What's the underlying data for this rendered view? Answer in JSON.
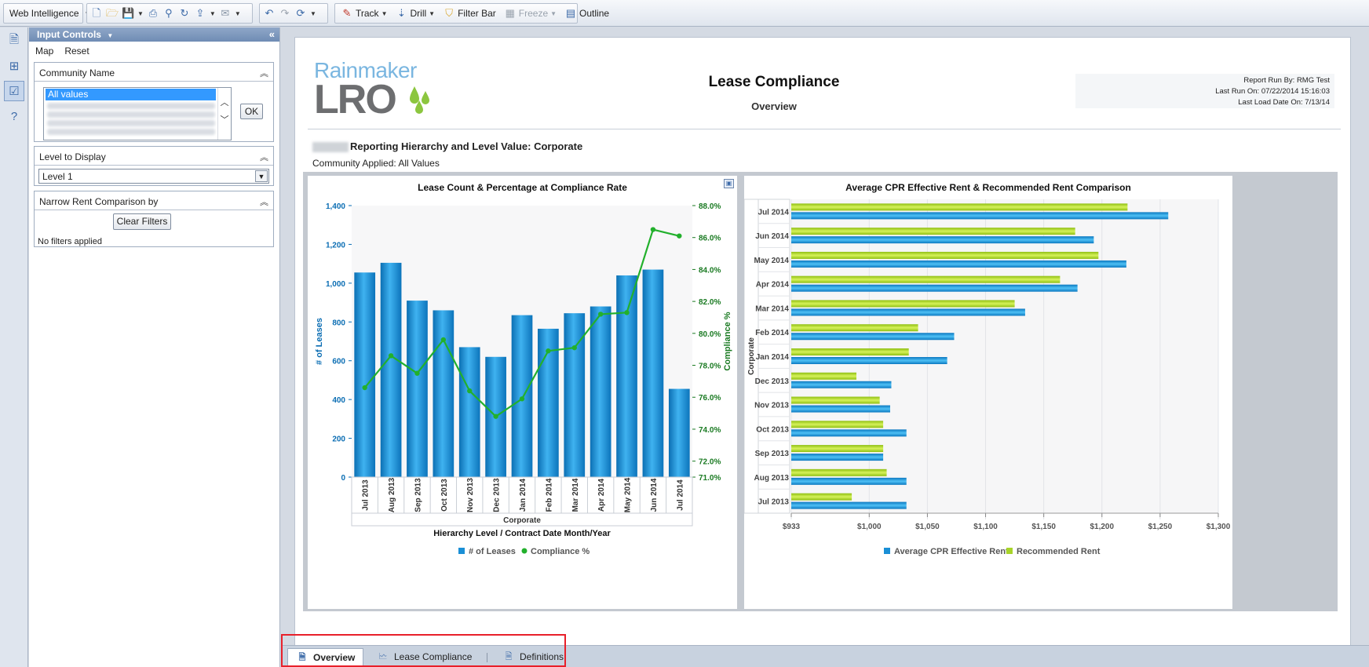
{
  "toolbar": {
    "app_menu": "Web Intelligence",
    "track": "Track",
    "drill": "Drill",
    "filter_bar": "Filter Bar",
    "freeze": "Freeze",
    "outline": "Outline"
  },
  "input_controls": {
    "title": "Input Controls",
    "menu_map": "Map",
    "menu_reset": "Reset",
    "community_title": "Community Name",
    "community_selected": "All values",
    "ok_label": "OK",
    "level_title": "Level to Display",
    "level_value": "Level 1",
    "narrow_title": "Narrow Rent Comparison by",
    "clear_filters": "Clear Filters",
    "no_filters": "No filters applied"
  },
  "report": {
    "logo_top": "Rainmaker",
    "logo_bottom": "LRO",
    "title": "Lease Compliance",
    "subtitle": "Overview",
    "run_by": "Report Run By:  RMG Test",
    "last_run": "Last Run On: 07/22/2014 15:16:03",
    "last_load": "Last Load Date On: 7/13/14",
    "hierarchy": "Reporting Hierarchy and Level Value: Corporate",
    "community_applied": "Community Applied: All Values"
  },
  "tabs": [
    "Overview",
    "Lease Compliance",
    "Definitions"
  ],
  "colors": {
    "bar_blue": "#1a8fd6",
    "line_green": "#22b02c",
    "recommended_green": "#a8d42a",
    "highlight_red": "#e8202a"
  },
  "chart_data": [
    {
      "type": "bar",
      "title": "Lease Count & Percentage at Compliance Rate",
      "categories": [
        "Jul 2013",
        "Aug 2013",
        "Sep 2013",
        "Oct 2013",
        "Nov 2013",
        "Dec 2013",
        "Jan 2014",
        "Feb 2014",
        "Mar 2014",
        "Apr 2014",
        "May 2014",
        "Jun 2014",
        "Jul 2014"
      ],
      "group_label": "Corporate",
      "xlabel": "Hierarchy Level / Contract Date Month/Year",
      "ylabel": "# of Leases",
      "y2label": "Compliance %",
      "ylim": [
        0,
        1400
      ],
      "yticks": [
        0,
        200,
        400,
        600,
        800,
        "1,000",
        "1,200",
        "1,400"
      ],
      "y2lim": [
        71,
        88
      ],
      "y2ticks": [
        "71.0%",
        "72.0%",
        "74.0%",
        "76.0%",
        "78.0%",
        "80.0%",
        "82.0%",
        "84.0%",
        "86.0%",
        "88.0%"
      ],
      "series": [
        {
          "name": "# of Leases",
          "kind": "bar",
          "values": [
            1055,
            1105,
            910,
            860,
            670,
            620,
            835,
            765,
            845,
            880,
            1040,
            1070,
            455
          ]
        },
        {
          "name": "Compliance %",
          "kind": "line",
          "values": [
            76.6,
            78.6,
            77.5,
            79.6,
            76.4,
            74.8,
            75.9,
            78.9,
            79.1,
            81.2,
            81.3,
            86.5,
            86.1
          ]
        }
      ],
      "legend": "bottom"
    },
    {
      "type": "bar",
      "orientation": "horizontal",
      "title": "Average CPR Effective Rent & Recommended Rent Comparison",
      "categories": [
        "Jul 2014",
        "Jun 2014",
        "May 2014",
        "Apr 2014",
        "Mar 2014",
        "Feb 2014",
        "Jan 2014",
        "Dec 2013",
        "Nov 2013",
        "Oct 2013",
        "Sep 2013",
        "Aug 2013",
        "Jul 2013"
      ],
      "group_label": "Corporate",
      "xlim": [
        933,
        1300
      ],
      "xticks": [
        "$933",
        "$1,000",
        "$1,050",
        "$1,100",
        "$1,150",
        "$1,200",
        "$1,250",
        "$1,300"
      ],
      "series": [
        {
          "name": "Recommended Rent",
          "values": [
            1222,
            1177,
            1197,
            1164,
            1125,
            1042,
            1034,
            989,
            1009,
            1012,
            1012,
            1015,
            985
          ]
        },
        {
          "name": "Average CPR Effective Rent",
          "values": [
            1257,
            1193,
            1221,
            1179,
            1134,
            1073,
            1067,
            1019,
            1018,
            1032,
            1012,
            1032,
            1032
          ]
        }
      ],
      "legend": "bottom"
    }
  ]
}
